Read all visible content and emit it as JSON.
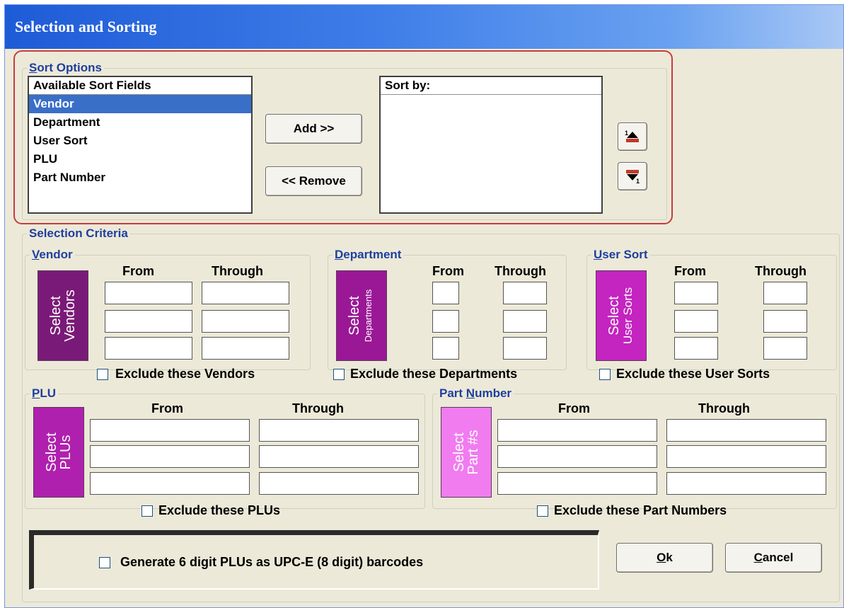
{
  "window": {
    "title": "Selection and Sorting"
  },
  "sort_options": {
    "legend": "Sort Options",
    "legend_accel": "S",
    "legend_rest": "ort Options",
    "available": {
      "header": "Available Sort Fields",
      "items": [
        "Vendor",
        "Department",
        "User Sort",
        "PLU",
        "Part Number"
      ],
      "selected": "Vendor"
    },
    "add_label": "Add >>",
    "remove_label": "<< Remove",
    "sort_by_header": "Sort by:",
    "move_up_icon": "move-up-icon",
    "move_down_icon": "move-down-icon"
  },
  "selection": {
    "legend": "Selection Criteria",
    "from": "From",
    "through": "Through",
    "vendor": {
      "legend_accel": "V",
      "legend_rest": "endor",
      "button_line1": "Select",
      "button_line2": "Vendors",
      "exclude": "Exclude these Vendors",
      "color": "#7a1a78"
    },
    "department": {
      "legend_accel": "D",
      "legend_rest": "epartment",
      "button_line1": "Select",
      "button_line2": "Departments",
      "exclude": "Exclude these Departments",
      "color": "#9a1896"
    },
    "user_sort": {
      "legend_accel": "U",
      "legend_rest": "ser Sort",
      "button_line1": "Select",
      "button_line2": "User Sorts",
      "exclude": "Exclude these User Sorts",
      "color": "#c424c0"
    },
    "plu": {
      "legend_accel": "P",
      "legend_rest": "LU",
      "button_line1": "Select",
      "button_line2": "PLUs",
      "exclude": "Exclude these PLUs",
      "color": "#b020ae"
    },
    "part_number": {
      "legend_pre": "Part ",
      "legend_accel": "N",
      "legend_rest": "umber",
      "button_line1": "Select",
      "button_line2": "Part #s",
      "exclude": "Exclude these Part Numbers",
      "color": "#f07cf0"
    }
  },
  "barcode": {
    "label": "Generate 6 digit PLUs as UPC-E (8 digit) barcodes"
  },
  "buttons": {
    "ok_accel": "O",
    "ok_rest": "k",
    "cancel_accel": "C",
    "cancel_rest": "ancel"
  }
}
